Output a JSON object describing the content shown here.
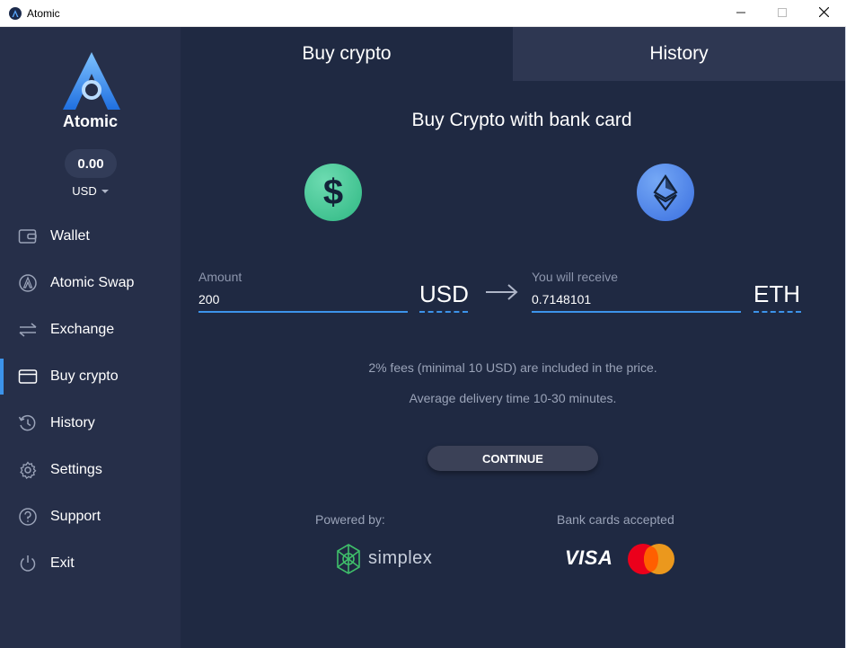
{
  "window": {
    "title": "Atomic",
    "controls": {
      "minimize": "minimize-icon",
      "maximize": "maximize-icon",
      "close": "close-icon"
    }
  },
  "sidebar": {
    "brand": "Atomic",
    "balance": "0.00",
    "currency": "USD",
    "items": [
      {
        "label": "Wallet",
        "icon": "wallet-icon"
      },
      {
        "label": "Atomic Swap",
        "icon": "atomic-swap-icon"
      },
      {
        "label": "Exchange",
        "icon": "exchange-arrows-icon"
      },
      {
        "label": "Buy crypto",
        "icon": "card-icon",
        "active": true
      },
      {
        "label": "History",
        "icon": "history-clock-icon"
      },
      {
        "label": "Settings",
        "icon": "gear-icon"
      },
      {
        "label": "Support",
        "icon": "question-circle-icon"
      },
      {
        "label": "Exit",
        "icon": "power-icon"
      }
    ]
  },
  "main": {
    "tabs": [
      {
        "label": "Buy crypto",
        "active": true
      },
      {
        "label": "History",
        "active": false
      }
    ],
    "heading": "Buy Crypto with bank card",
    "amount": {
      "label": "Amount",
      "value": "200",
      "unit": "USD"
    },
    "receive": {
      "label": "You will receive",
      "value": "0.7148101",
      "unit": "ETH"
    },
    "fees_note": "2% fees (minimal 10 USD) are included in the price.",
    "delivery_note": "Average delivery time 10-30 minutes.",
    "continue_label": "CONTINUE",
    "powered_by": "Powered by:",
    "provider": "simplex",
    "cards_accepted": "Bank cards accepted",
    "card_brands": [
      "VISA",
      "mastercard"
    ]
  },
  "colors": {
    "background": "#1f2942",
    "sidebar": "#262f49",
    "accent": "#3c93ea",
    "usd_coin": "#3cc38f",
    "eth_coin": "#4a80e8"
  }
}
